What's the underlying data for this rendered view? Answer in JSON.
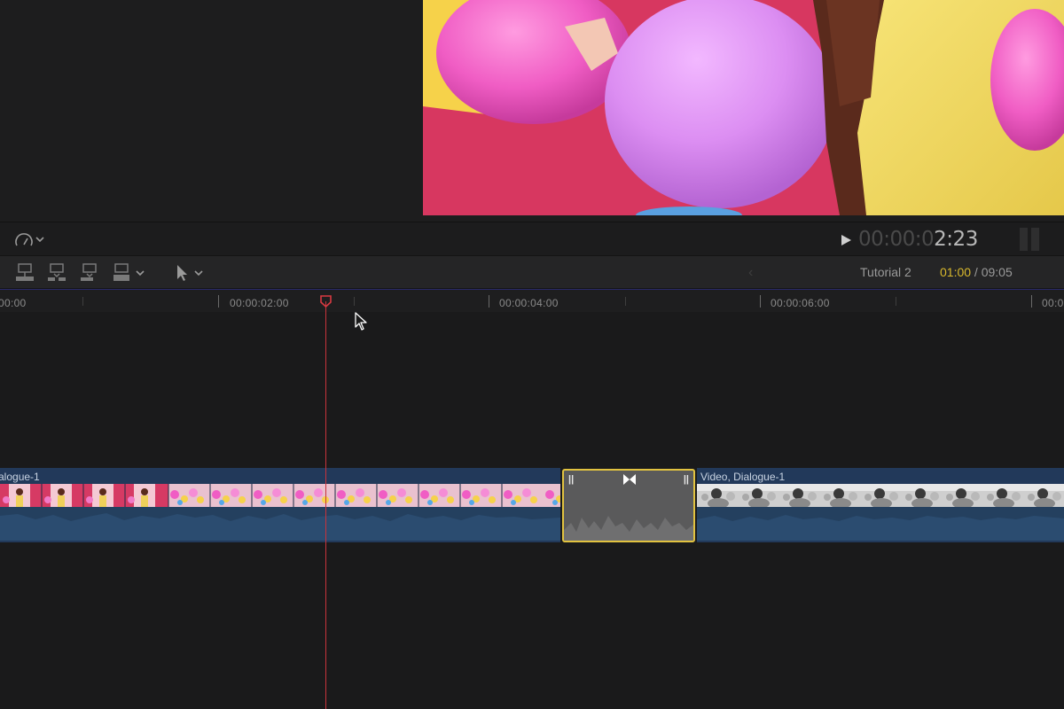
{
  "viewer": {
    "timecode_dim": "00:00:0",
    "timecode_lit": "2:23",
    "speed_icon": "speedometer-icon",
    "play_icon": "play-icon"
  },
  "toolbar": {
    "edit_buttons": [
      "connect-clip-icon",
      "insert-clip-icon",
      "append-clip-icon",
      "overwrite-clip-icon"
    ],
    "select_tool_icon": "arrow-pointer-icon",
    "back_glyph": "‹",
    "project_name": "Tutorial 2",
    "current_duration": "01:00",
    "separator": " / ",
    "total_duration": "09:05"
  },
  "ruler": {
    "labels": [
      "00:00",
      "00:00:02:00",
      "00:00:04:00",
      "00:00:06:00",
      "00:0"
    ]
  },
  "clips": [
    {
      "label": "alogue-1"
    },
    {
      "label": "Video, Dialogue-1"
    }
  ],
  "transition": {
    "handle_glyph": "||"
  },
  "colors": {
    "accent_yellow": "#d9b92d",
    "transition_border": "#e2c340",
    "playhead": "#c9333b",
    "clip_blue": "#22395a"
  }
}
